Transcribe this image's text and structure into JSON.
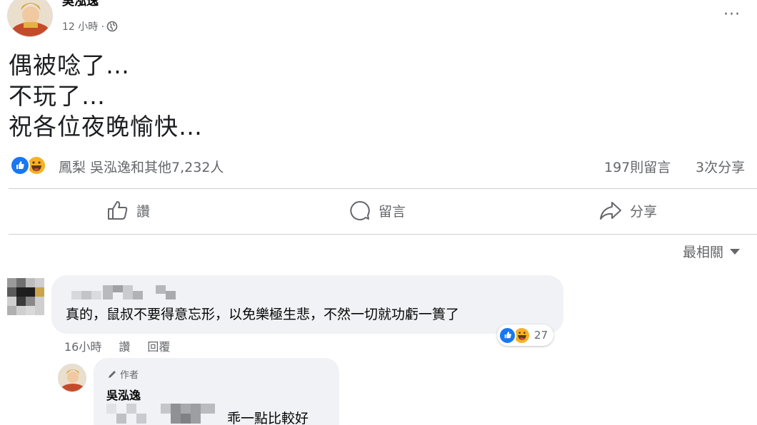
{
  "post": {
    "author": "吳泓逸",
    "time": "12 小時 ·",
    "lines": [
      "偶被唸了…",
      "不玩了…",
      "祝各位夜晚愉快…"
    ],
    "menu": "···",
    "reactions_text": "鳳梨 吳泓逸和其他7,232人",
    "comment_count": "197則留言",
    "share_count": "3次分享",
    "reaction_icons": [
      "like-icon",
      "haha-icon"
    ]
  },
  "actions": {
    "like": "讚",
    "comment": "留言",
    "share": "分享"
  },
  "sort": {
    "label": "最相關"
  },
  "comment1": {
    "text": "真的，鼠叔不要得意忘形，以免樂極生悲，不然一切就功虧一簣了",
    "reaction_count": "27",
    "time": "16小時",
    "like": "讚",
    "reply": "回覆"
  },
  "reply1": {
    "badge": "作者",
    "author": "吳泓逸",
    "text": "乖一點比較好"
  },
  "colors": {
    "like_blue": "#1877f2",
    "haha_yellow": "#f7b125",
    "muted_text": "#65676b",
    "bubble_bg": "#f0f2f5"
  }
}
